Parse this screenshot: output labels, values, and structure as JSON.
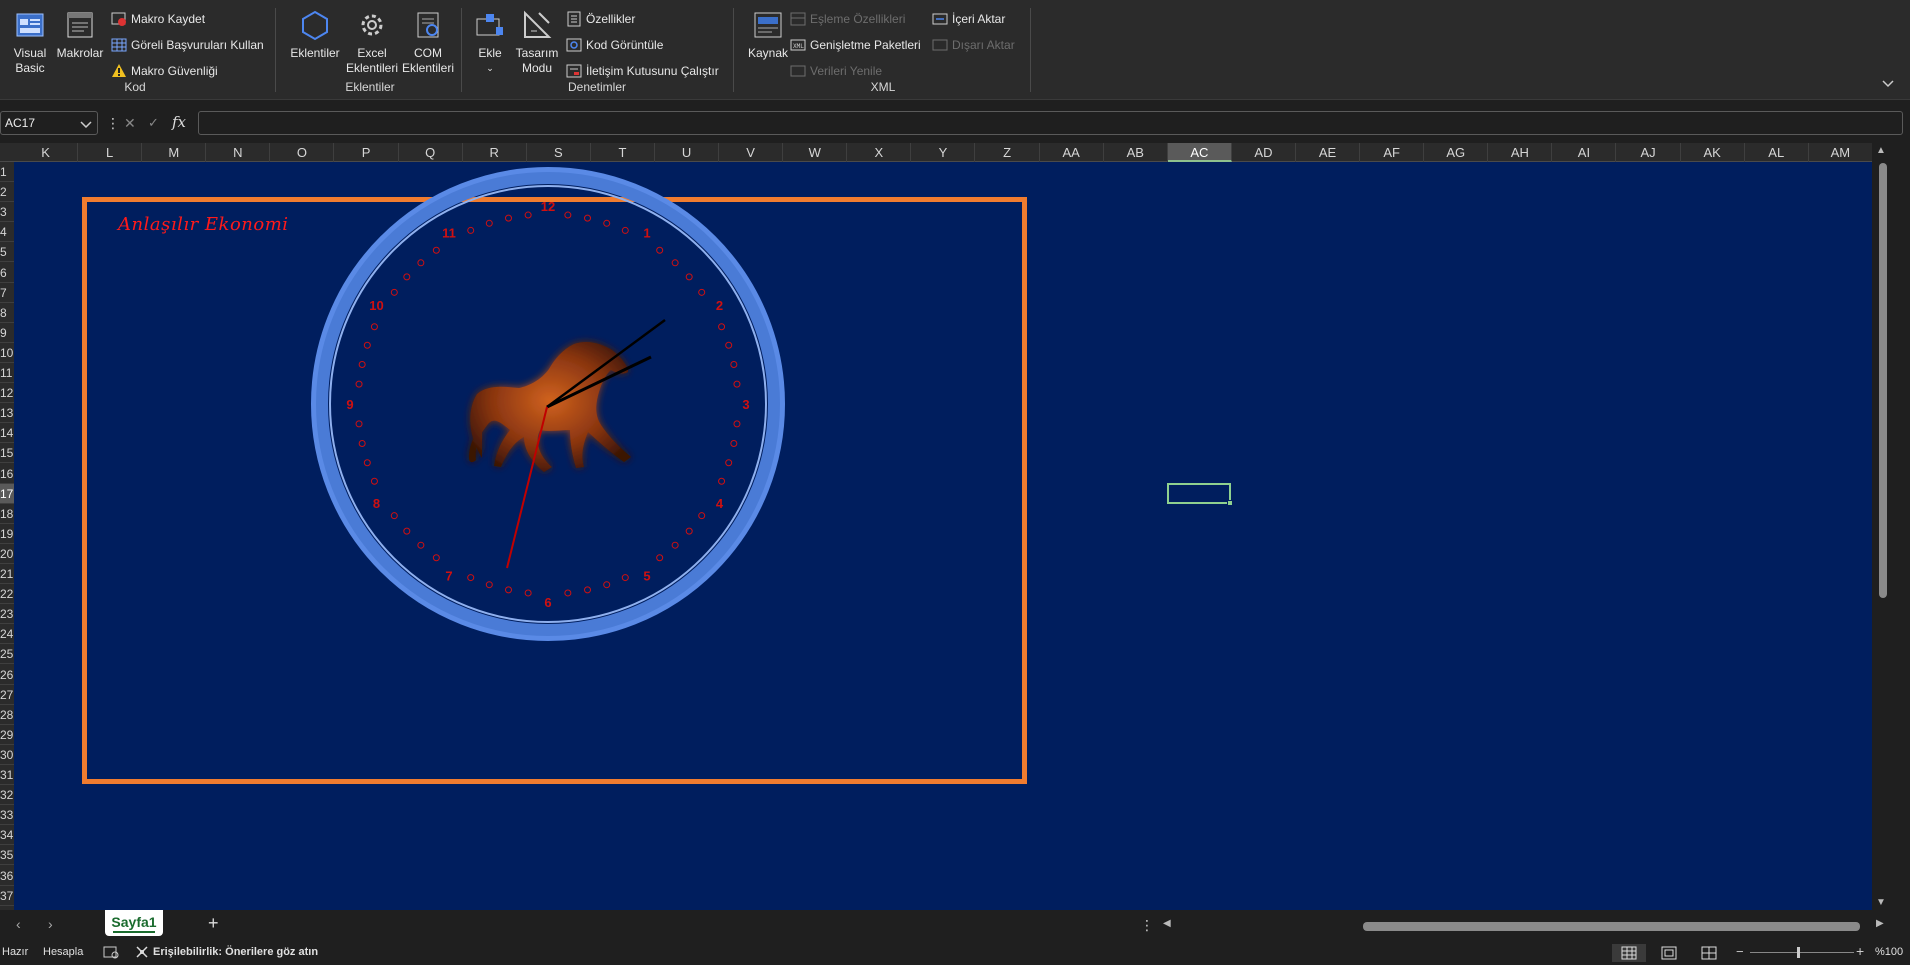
{
  "ribbon": {
    "kod": {
      "label": "Kod",
      "visual_basic": "Visual\nBasic",
      "makrolar": "Makrolar",
      "makro_kaydet": "Makro Kaydet",
      "goreli": "Göreli Başvuruları Kullan",
      "makro_guvenligi": "Makro Güvenliği"
    },
    "eklentiler": {
      "label": "Eklentiler",
      "eklentiler": "Eklentiler",
      "excel_eklentileri": "Excel\nEklentileri",
      "com_eklentileri": "COM\nEklentileri"
    },
    "denetimler": {
      "label": "Denetimler",
      "ekle": "Ekle",
      "tasarim_modu": "Tasarım\nModu",
      "ozellikler": "Özellikler",
      "kod_goruntule": "Kod Görüntüle",
      "iletisim": "İletişim Kutusunu Çalıştır"
    },
    "xml": {
      "label": "XML",
      "kaynak": "Kaynak",
      "esleme": "Eşleme Özellikleri",
      "genisletme": "Genişletme Paketleri",
      "verileri_yenile": "Verileri Yenile",
      "iceri_aktar": "İçeri Aktar",
      "disari_aktar": "Dışarı Aktar"
    }
  },
  "formula_bar": {
    "name_box": "AC17",
    "fx": "fx",
    "value": ""
  },
  "columns": [
    "K",
    "L",
    "M",
    "N",
    "O",
    "P",
    "Q",
    "R",
    "S",
    "T",
    "U",
    "V",
    "W",
    "X",
    "Y",
    "Z",
    "AA",
    "AB",
    "AC",
    "AD",
    "AE",
    "AF",
    "AG",
    "AH",
    "AI",
    "AJ",
    "AK",
    "AL",
    "AM"
  ],
  "selected_column": "AC",
  "rows": [
    "1",
    "2",
    "3",
    "4",
    "5",
    "6",
    "7",
    "8",
    "9",
    "10",
    "11",
    "12",
    "13",
    "14",
    "15",
    "16",
    "17",
    "18",
    "19",
    "20",
    "21",
    "22",
    "23",
    "24",
    "25",
    "26",
    "27",
    "28",
    "29",
    "30",
    "31",
    "32",
    "33",
    "34",
    "35",
    "36",
    "37"
  ],
  "selected_row": "17",
  "picture": {
    "brand": "Anlaşılır Ekonomi",
    "clock_numbers": [
      "12",
      "1",
      "2",
      "3",
      "4",
      "5",
      "6",
      "7",
      "8",
      "9",
      "10",
      "11"
    ],
    "colors": {
      "frame": "#f07c2f",
      "ring": "#4a7bd6",
      "numerals": "#d01010",
      "background": "#001e5e"
    }
  },
  "sheet_tab": "Sayfa1",
  "status": {
    "ready": "Hazır",
    "calc": "Hesapla",
    "accessibility": "Erişilebilirlik: Önerilere göz atın",
    "zoom": "%100"
  }
}
